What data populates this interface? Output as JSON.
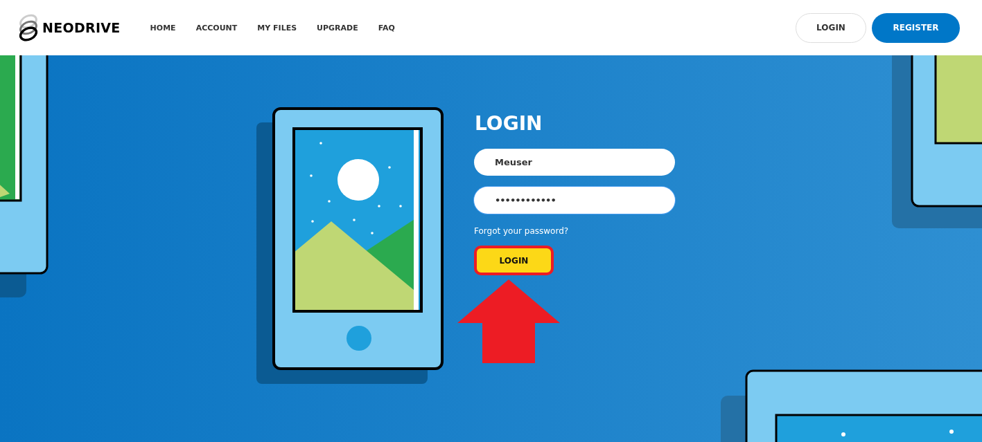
{
  "header": {
    "brand": "NEODRIVE",
    "nav": [
      {
        "label": "HOME"
      },
      {
        "label": "ACCOUNT"
      },
      {
        "label": "MY FILES"
      },
      {
        "label": "UPGRADE"
      },
      {
        "label": "FAQ"
      }
    ],
    "buttons": [
      {
        "label": "LOGIN",
        "kind": "outline"
      },
      {
        "label": "REGISTER",
        "kind": "primary"
      }
    ]
  },
  "login_form": {
    "title": "LOGIN",
    "fields": [
      {
        "kind": "text",
        "value": "Meuser",
        "focused": false
      },
      {
        "kind": "password",
        "value": "••••••••••••",
        "focused": true
      }
    ],
    "forgot_link": "Forgot your password?",
    "submit": {
      "label": "LOGIN",
      "highlighted": true
    },
    "pointer_arrow": true
  }
}
